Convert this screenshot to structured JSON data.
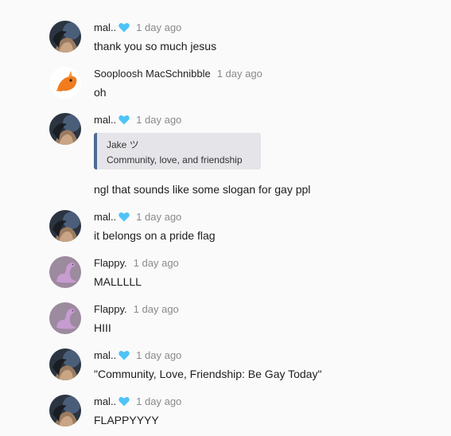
{
  "messages": [
    {
      "author": "mal..",
      "author_badge": "blue-heart-emoji",
      "avatar": "dark-photo-avatar",
      "time": "1 day ago",
      "text": "thank you so much jesus"
    },
    {
      "author": "Sooploosh MacSchnibble",
      "avatar": "orange-creature-avatar",
      "time": "1 day ago",
      "text": "oh"
    },
    {
      "author": "mal..",
      "author_badge": "blue-heart-emoji",
      "avatar": "dark-photo-avatar",
      "time": "1 day ago",
      "quote": {
        "author": "Jake ツ",
        "text": "Community, love, and friendship"
      },
      "text": "ngl that sounds like some slogan for gay ppl"
    },
    {
      "author": "mal..",
      "author_badge": "blue-heart-emoji",
      "avatar": "dark-photo-avatar",
      "time": "1 day ago",
      "text": "it belongs on a pride flag"
    },
    {
      "author": "Flappy.",
      "avatar": "purple-dinosaur-avatar",
      "time": "1 day ago",
      "text": "MALLLLL"
    },
    {
      "author": "Flappy.",
      "avatar": "purple-dinosaur-avatar",
      "time": "1 day ago",
      "text": "HIII"
    },
    {
      "author": "mal..",
      "author_badge": "blue-heart-emoji",
      "avatar": "dark-photo-avatar",
      "time": "1 day ago",
      "text": "\"Community, Love, Friendship: Be Gay Today\""
    },
    {
      "author": "mal..",
      "author_badge": "blue-heart-emoji",
      "avatar": "dark-photo-avatar",
      "time": "1 day ago",
      "text": "FLAPPYYYY"
    }
  ],
  "colors": {
    "background": "#fafafa",
    "timestamp": "#8a8a8a",
    "quote_background": "#e5e5e9",
    "quote_accent": "#4f6b94",
    "heart": "#4fc3f7"
  }
}
